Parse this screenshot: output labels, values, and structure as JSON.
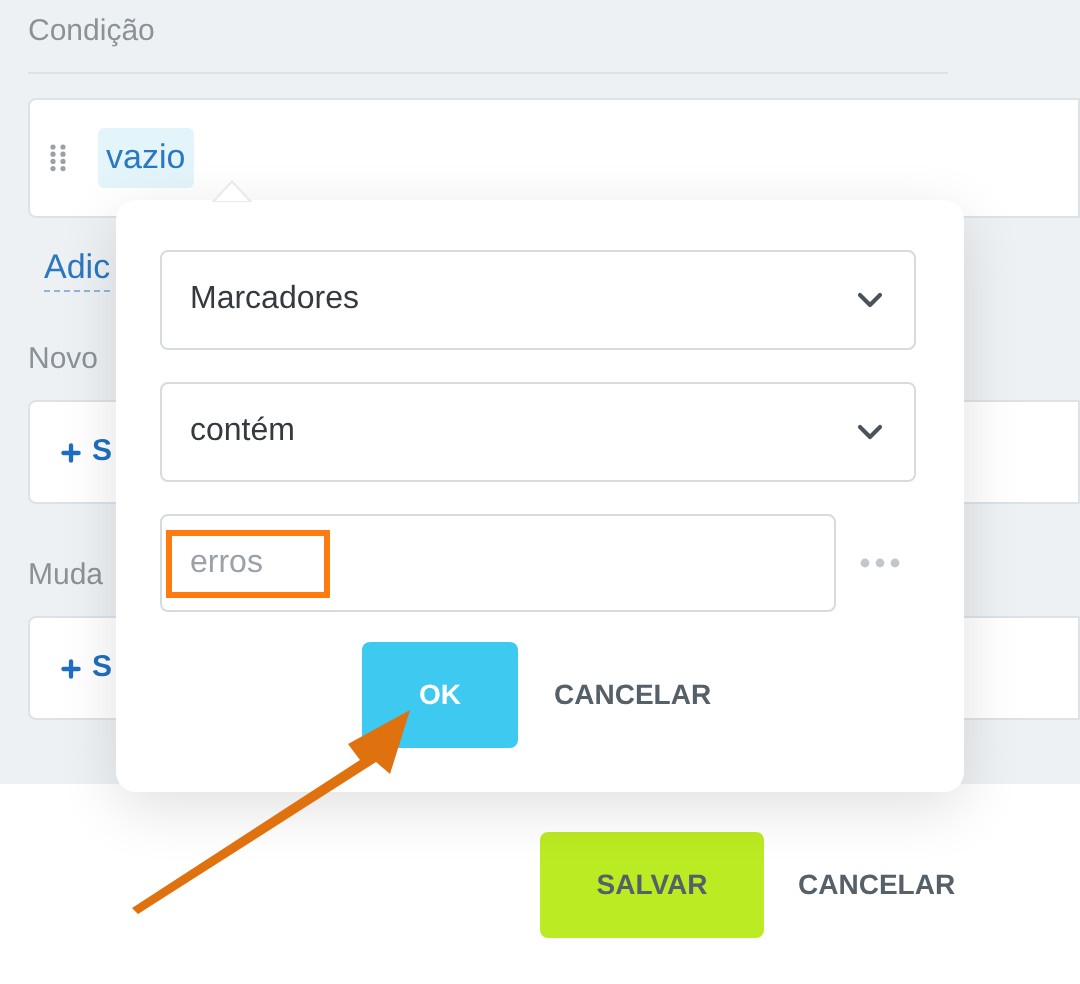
{
  "condition": {
    "label": "Condição",
    "tag": "vazio",
    "add_link": "Adic"
  },
  "sections": [
    {
      "label": "Novo",
      "action": "S"
    },
    {
      "label": "Muda",
      "action": "S"
    }
  ],
  "popup": {
    "selects": [
      {
        "value": "Marcadores"
      },
      {
        "value": "contém"
      }
    ],
    "input": {
      "placeholder": "erros",
      "highlighted": true
    },
    "ok": "OK",
    "cancel": "CANCELAR"
  },
  "footer": {
    "save": "SALVAR",
    "cancel": "CANCELAR"
  }
}
